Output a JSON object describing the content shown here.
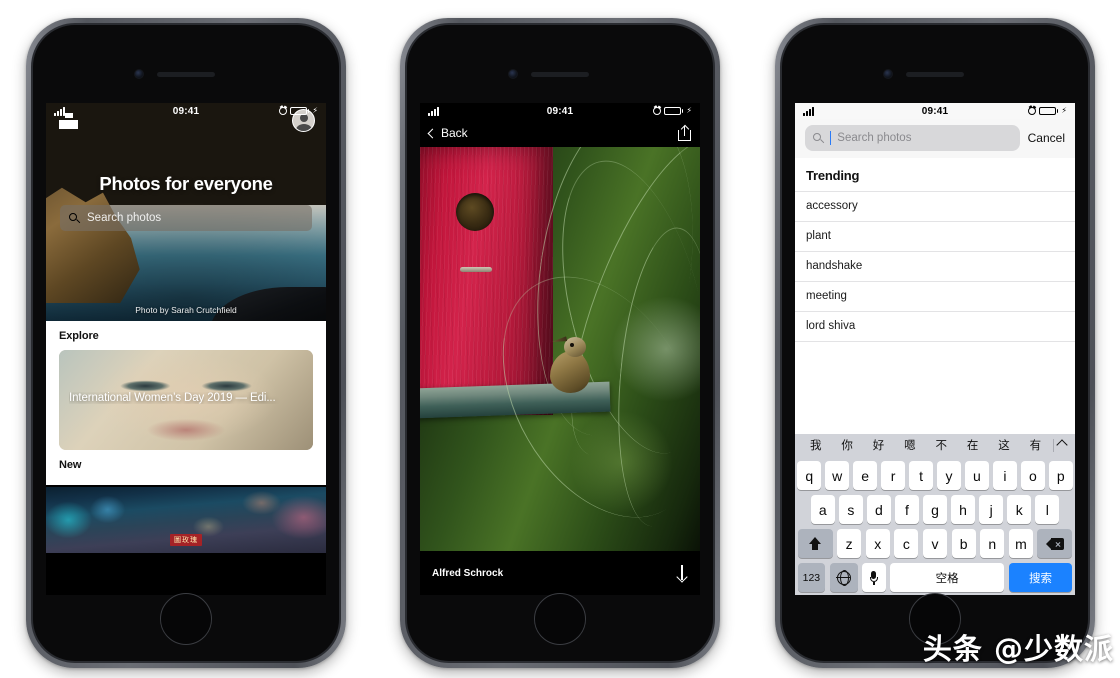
{
  "status_bar": {
    "time": "09:41",
    "carrier_signal": "signal-bars",
    "alarm": "alarm-icon",
    "battery": "battery-full",
    "charging": "charging-bolt"
  },
  "phone1": {
    "name": "Unsplash home screen",
    "logo": "unsplash-logo",
    "avatar": "user-avatar",
    "hero_title": "Photos for everyone",
    "search_placeholder": "Search photos",
    "photo_credit": "Photo by Sarah Crutchfield",
    "sections": [
      {
        "heading": "Explore",
        "card_title": "International Women’s Day 2019 — Edi..."
      },
      {
        "heading": "New",
        "strip_sign": "圖玫瑰"
      }
    ]
  },
  "phone2": {
    "name": "Photo detail screen",
    "back_label": "Back",
    "share_icon": "share-icon",
    "author": "Alfred Schrock",
    "download_icon": "download-arrow-icon"
  },
  "phone3": {
    "name": "Search screen with keyboard",
    "search_placeholder": "Search photos",
    "search_value": "",
    "cancel_label": "Cancel",
    "trending_heading": "Trending",
    "trending_items": [
      "accessory",
      "plant",
      "handshake",
      "meeting",
      "lord shiva"
    ],
    "keyboard": {
      "candidates": [
        "我",
        "你",
        "好",
        "嗯",
        "不",
        "在",
        "这",
        "有"
      ],
      "expand_icon": "chevron-up-icon",
      "row1": [
        "q",
        "w",
        "e",
        "r",
        "t",
        "y",
        "u",
        "i",
        "o",
        "p"
      ],
      "row2": [
        "a",
        "s",
        "d",
        "f",
        "g",
        "h",
        "j",
        "k",
        "l"
      ],
      "row3": [
        "z",
        "x",
        "c",
        "v",
        "b",
        "n",
        "m"
      ],
      "shift_icon": "shift-icon",
      "delete_icon": "delete-icon",
      "numeric_label": "123",
      "globe_icon": "globe-icon",
      "mic_icon": "microphone-icon",
      "space_label": "空格",
      "search_label": "搜索",
      "accent_color": "#1b82ff"
    }
  },
  "watermark": "头条 @少数派"
}
